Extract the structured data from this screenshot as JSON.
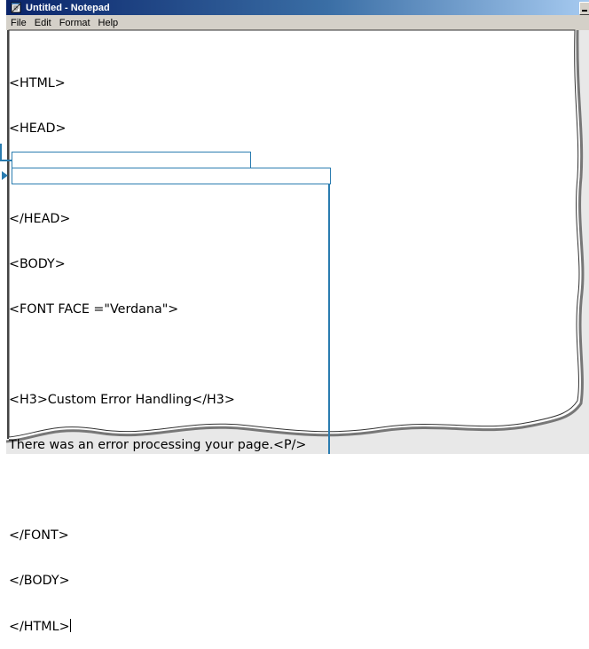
{
  "window": {
    "title": "Untitled - Notepad"
  },
  "menu": [
    "File",
    "Edit",
    "Format",
    "Help"
  ],
  "code_lines": [
    "<HTML>",
    "<HEAD>",
    "",
    "</HEAD>",
    "<BODY>",
    "<FONT FACE =\"Verdana\">",
    "",
    "<H3>Custom Error Handling</H3>",
    "There was an error processing your page.<P/>",
    "",
    "</FONT>",
    "</BODY>",
    "</HTML>"
  ],
  "colors": {
    "title_gradient_start": "#0a246a",
    "title_gradient_end": "#a6caf0",
    "callout": "#2a7cb0"
  }
}
